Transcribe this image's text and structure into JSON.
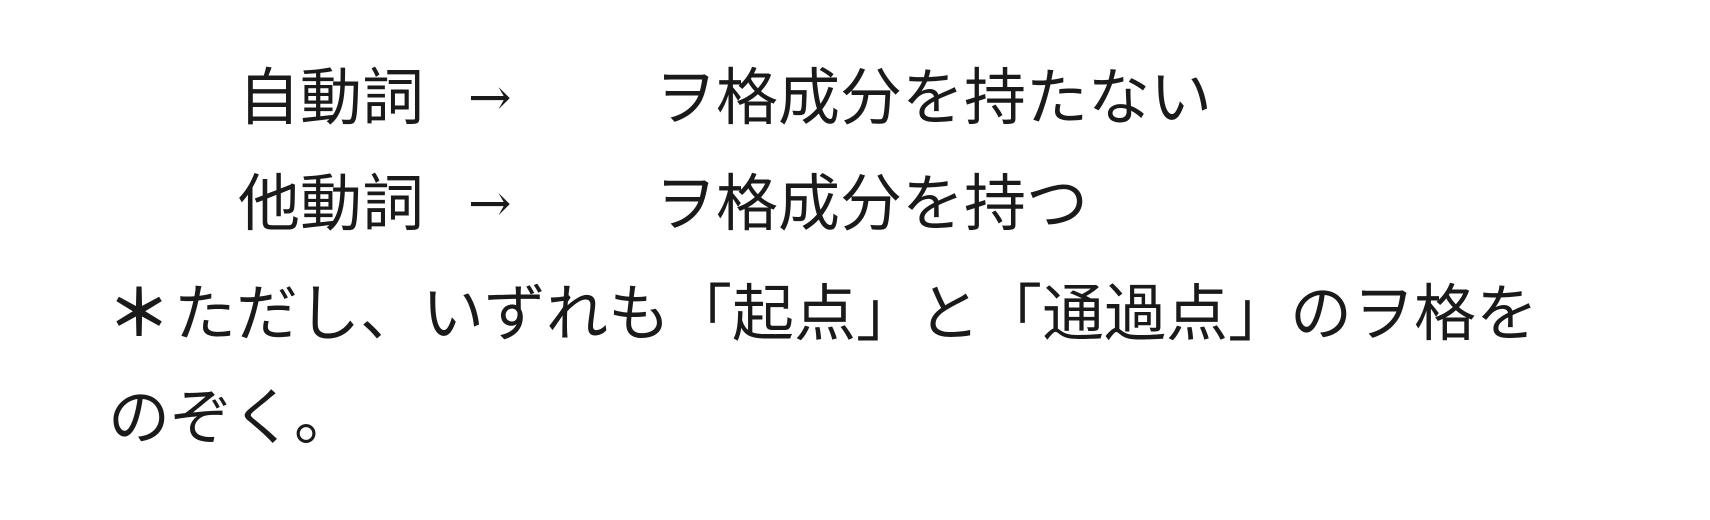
{
  "rules": [
    {
      "term": "自動詞",
      "arrow": "→",
      "description": "ヲ格成分を持たない"
    },
    {
      "term": "他動詞",
      "arrow": "→",
      "description": "ヲ格成分を持つ"
    }
  ],
  "note": {
    "mark": "＊",
    "line1": "ただし、いずれも「起点」と「通過点」のヲ格を",
    "line2": "のぞく。"
  }
}
